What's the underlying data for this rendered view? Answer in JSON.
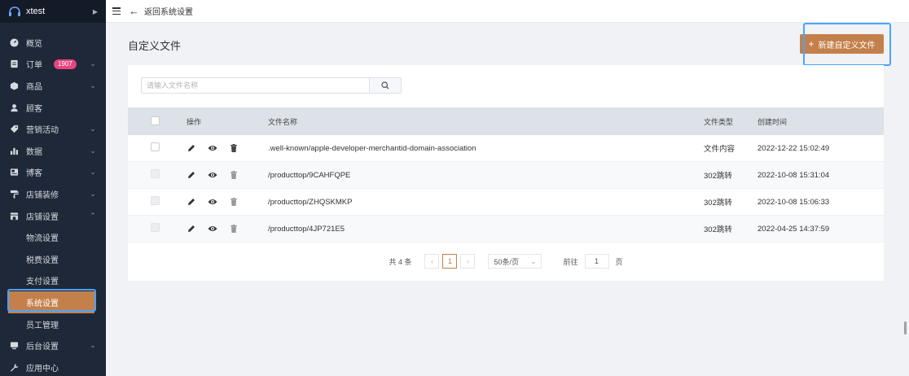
{
  "sidebar": {
    "brand": "xtest",
    "items": [
      {
        "label": "概览",
        "icon": "dashboard-icon"
      },
      {
        "label": "订单",
        "icon": "order-icon",
        "badge": "1907",
        "chevron": true
      },
      {
        "label": "商品",
        "icon": "product-icon",
        "chevron": true
      },
      {
        "label": "顾客",
        "icon": "customer-icon"
      },
      {
        "label": "营销活动",
        "icon": "tag-icon",
        "chevron": true
      },
      {
        "label": "数据",
        "icon": "chart-icon",
        "chevron": true
      },
      {
        "label": "博客",
        "icon": "blog-icon",
        "chevron": true
      },
      {
        "label": "店铺装修",
        "icon": "paint-roller-icon",
        "chevron": true
      },
      {
        "label": "店铺设置",
        "icon": "store-icon",
        "chevron": true,
        "expanded": true
      }
    ],
    "sub_items": [
      "物流设置",
      "税费设置",
      "支付设置",
      "系统设置",
      "员工管理"
    ],
    "active_sub": "系统设置",
    "bottom_items": [
      {
        "label": "后台设置",
        "icon": "monitor-icon",
        "chevron": true
      },
      {
        "label": "应用中心",
        "icon": "wrench-icon"
      }
    ]
  },
  "topbar": {
    "back_label": "返回系统设置"
  },
  "page": {
    "title": "自定义文件",
    "new_button": "新建自定义文件"
  },
  "search": {
    "placeholder": "请输入文件名称"
  },
  "table": {
    "headers": {
      "ops": "操作",
      "name": "文件名称",
      "type": "文件类型",
      "time": "创建时间"
    },
    "rows": [
      {
        "name": ".well-known/apple-developer-merchantid-domain-association",
        "type": "文件内容",
        "time": "2022-12-22 15:02:49"
      },
      {
        "name": "/producttop/9CAHFQPE",
        "type": "302跳转",
        "time": "2022-10-08 15:31:04"
      },
      {
        "name": "/producttop/ZHQSKMKP",
        "type": "302跳转",
        "time": "2022-10-08 15:06:33"
      },
      {
        "name": "/producttop/4JP721E5",
        "type": "302跳转",
        "time": "2022-04-25 14:37:59"
      }
    ]
  },
  "pager": {
    "total": "共 4 条",
    "current": "1",
    "page_size": "50条/页",
    "goto_label": "前往",
    "goto_value": "1",
    "page_unit": "页"
  },
  "colors": {
    "accent": "#c4804a",
    "sidebar_bg": "#1f2838",
    "badge": "#e7457f",
    "highlight": "#4aa3ff"
  }
}
